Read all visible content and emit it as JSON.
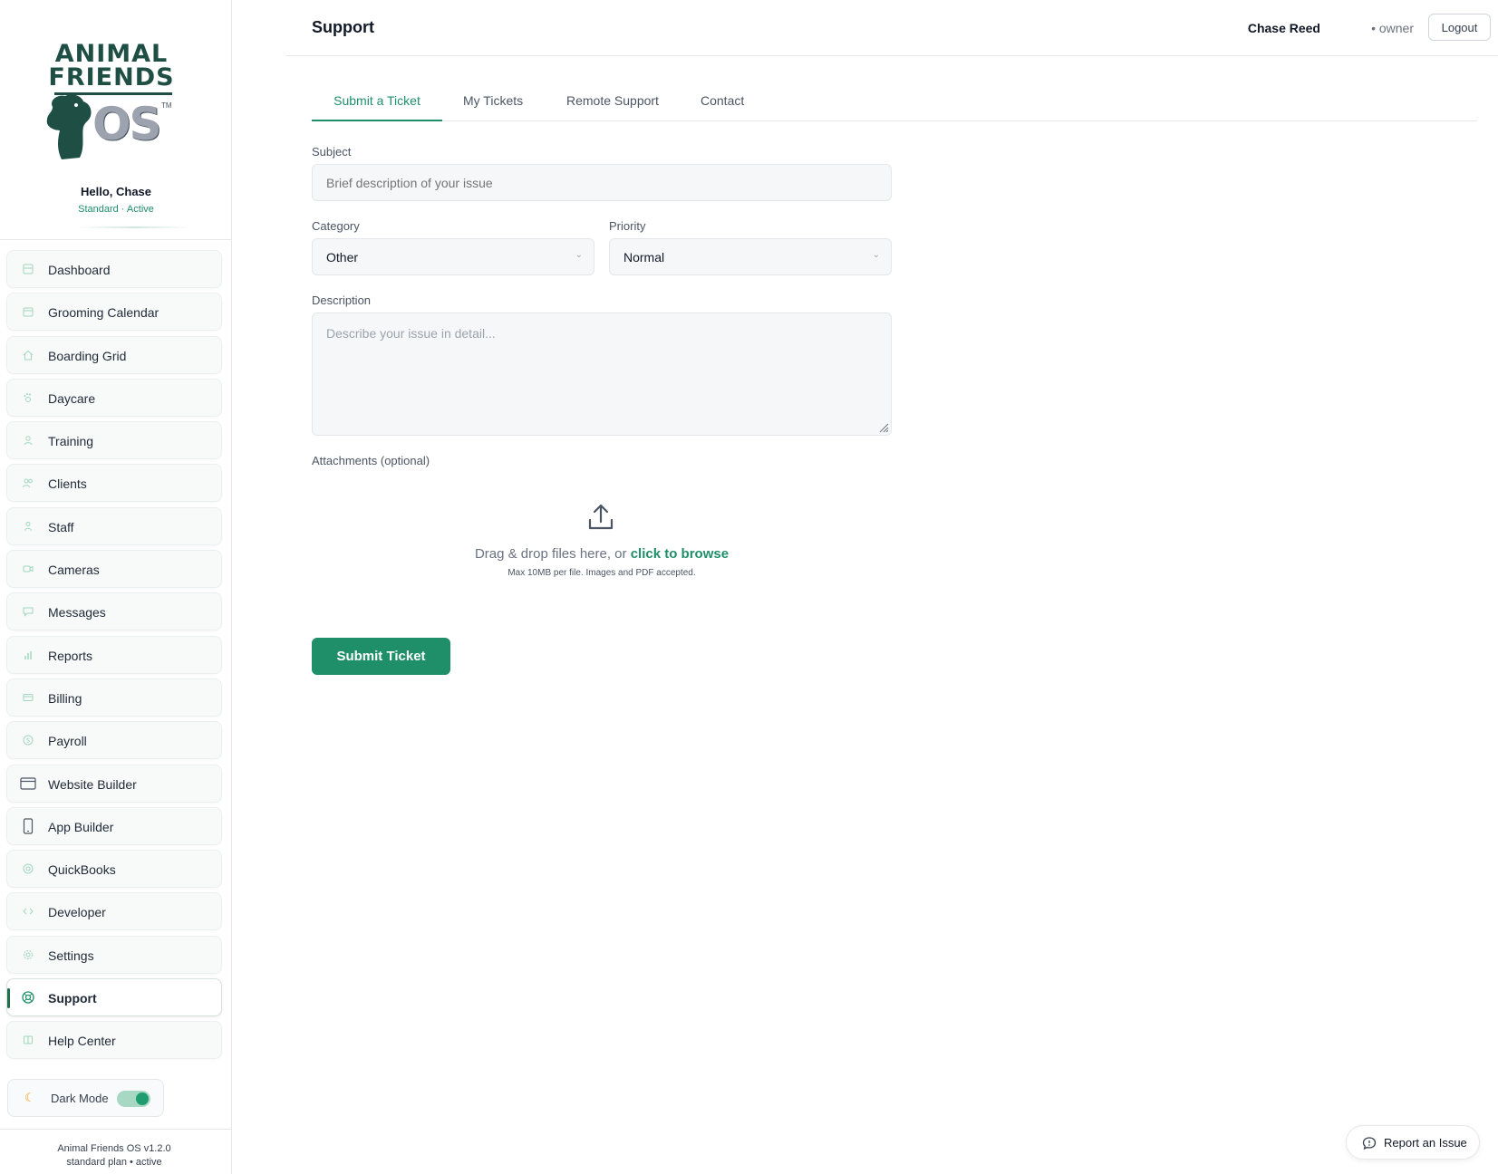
{
  "brand": {
    "line1": "ANIMAL",
    "line2": "FRIENDS",
    "os": "OS",
    "tm": "TM"
  },
  "greeting": {
    "hello": "Hello, Chase",
    "plan": "Standard · Active"
  },
  "sidebar": {
    "items": [
      {
        "label": "Dashboard",
        "icon": "dashboard-icon"
      },
      {
        "label": "Grooming Calendar",
        "icon": "calendar-icon"
      },
      {
        "label": "Boarding Grid",
        "icon": "home-icon"
      },
      {
        "label": "Daycare",
        "icon": "paw-icon"
      },
      {
        "label": "Training",
        "icon": "trainer-icon"
      },
      {
        "label": "Clients",
        "icon": "users-icon"
      },
      {
        "label": "Staff",
        "icon": "staff-icon"
      },
      {
        "label": "Cameras",
        "icon": "camera-icon"
      },
      {
        "label": "Messages",
        "icon": "message-icon"
      },
      {
        "label": "Reports",
        "icon": "bar-chart-icon"
      },
      {
        "label": "Billing",
        "icon": "billing-icon"
      },
      {
        "label": "Payroll",
        "icon": "dollar-icon"
      },
      {
        "label": "Website Builder",
        "icon": "browser-icon"
      },
      {
        "label": "App Builder",
        "icon": "mobile-icon"
      },
      {
        "label": "QuickBooks",
        "icon": "quickbooks-icon"
      },
      {
        "label": "Developer",
        "icon": "code-icon"
      },
      {
        "label": "Settings",
        "icon": "gear-icon"
      },
      {
        "label": "Support",
        "icon": "lifebuoy-icon",
        "active": true
      },
      {
        "label": "Help Center",
        "icon": "book-icon"
      }
    ],
    "dark_mode": {
      "label": "Dark Mode",
      "enabled": true
    },
    "version": "Animal Friends OS v1.2.0",
    "plan_status": "standard plan • active"
  },
  "header": {
    "title": "Support",
    "user_name": "Chase Reed",
    "user_role": "• owner",
    "logout_label": "Logout"
  },
  "tabs": [
    {
      "label": "Submit a Ticket",
      "active": true
    },
    {
      "label": "My Tickets"
    },
    {
      "label": "Remote Support"
    },
    {
      "label": "Contact"
    }
  ],
  "form": {
    "subject": {
      "label": "Subject",
      "placeholder": "Brief description of your issue",
      "value": ""
    },
    "category": {
      "label": "Category",
      "value": "Other"
    },
    "priority": {
      "label": "Priority",
      "value": "Normal"
    },
    "description": {
      "label": "Description",
      "placeholder": "Describe your issue in detail..."
    },
    "attachments": {
      "label": "Attachments (optional)",
      "drop_text": "Drag & drop files here, or ",
      "browse_text": "click to browse",
      "hint": "Max 10MB per file. Images and PDF accepted."
    },
    "submit_label": "Submit Ticket"
  },
  "report_issue": {
    "label": "Report an Issue"
  },
  "colors": {
    "accent": "#1f8f6a",
    "brand_dark": "#1f4f44"
  }
}
